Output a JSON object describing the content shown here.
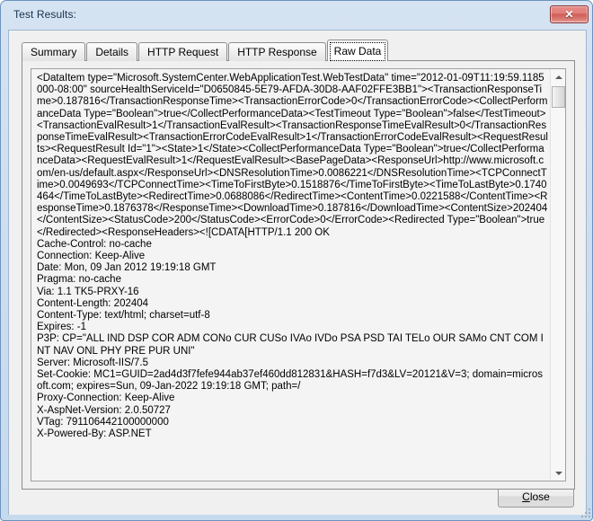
{
  "window": {
    "title": "Test Results:",
    "close_icon": "close-icon",
    "close_glyph": "✕"
  },
  "tabs": [
    {
      "label": "Summary",
      "selected": false
    },
    {
      "label": "Details",
      "selected": false
    },
    {
      "label": "HTTP Request",
      "selected": false
    },
    {
      "label": "HTTP Response",
      "selected": false
    },
    {
      "label": "Raw Data",
      "selected": true
    }
  ],
  "raw_data": {
    "text": "<DataItem type=\"Microsoft.SystemCenter.WebApplicationTest.WebTestData\" time=\"2012-01-09T11:19:59.1185000-08:00\" sourceHealthServiceId=\"D0650845-5E79-AFDA-30D8-AAF02FFE3BB1\"><TransactionResponseTime>0.187816</TransactionResponseTime><TransactionErrorCode>0</TransactionErrorCode><CollectPerformanceData Type=\"Boolean\">true</CollectPerformanceData><TestTimeout Type=\"Boolean\">false</TestTimeout><TransactionEvalResult>1</TransactionEvalResult><TransactionResponseTimeEvalResult>0</TransactionResponseTimeEvalResult><TransactionErrorCodeEvalResult>1</TransactionErrorCodeEvalResult><RequestResults><RequestResult Id=\"1\"><State>1</State><CollectPerformanceData Type=\"Boolean\">true</CollectPerformanceData><RequestEvalResult>1</RequestEvalResult><BasePageData><ResponseUrl>http://www.microsoft.com/en-us/default.aspx</ResponseUrl><DNSResolutionTime>0.0086221</DNSResolutionTime><TCPConnectTime>0.0049693</TCPConnectTime><TimeToFirstByte>0.1518876</TimeToFirstByte><TimeToLastByte>0.1740464</TimeToLastByte><RedirectTime>0.0688086</RedirectTime><ContentTime>0.0221588</ContentTime><ResponseTime>0.1876378</ResponseTime><DownloadTime>0.187816</DownloadTime><ContentSize>202404</ContentSize><StatusCode>200</StatusCode><ErrorCode>0</ErrorCode><Redirected Type=\"Boolean\">true</Redirected><ResponseHeaders><![CDATA[HTTP/1.1 200 OK\nCache-Control: no-cache\nConnection: Keep-Alive\nDate: Mon, 09 Jan 2012 19:19:18 GMT\nPragma: no-cache\nVia: 1.1 TK5-PRXY-16\nContent-Length: 202404\nContent-Type: text/html; charset=utf-8\nExpires: -1\nP3P: CP=\"ALL IND DSP COR ADM CONo CUR CUSo IVAo IVDo PSA PSD TAI TELo OUR SAMo CNT COM INT NAV ONL PHY PRE PUR UNI\"\nServer: Microsoft-IIS/7.5\nSet-Cookie: MC1=GUID=2ad4d3f7fefe944ab37ef460dd812831&HASH=f7d3&LV=20121&V=3; domain=microsoft.com; expires=Sun, 09-Jan-2022 19:19:18 GMT; path=/\nProxy-Connection: Keep-Alive\nX-AspNet-Version: 2.0.50727\nVTag: 791106442100000000\nX-Powered-By: ASP.NET"
  },
  "scrollbar": {
    "up_icon": "scroll-up-arrow-icon",
    "down_icon": "scroll-down-arrow-icon",
    "thumb_icon": "scrollbar-thumb"
  },
  "footer": {
    "close_label": "Close",
    "close_accel": "C",
    "close_rest": "lose"
  }
}
